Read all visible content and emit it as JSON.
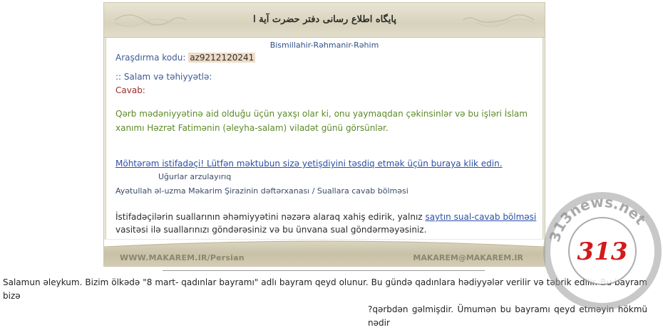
{
  "header": {
    "calligraphy_text": "پایگاه اطلاع رسانی دفتر حضرت آیة الله العظمی مکارم شیرازی"
  },
  "content": {
    "bismillah": "Bismillahir-Rəhmanir-Rəhim",
    "tracking_label": "Araşdırma kodu:",
    "tracking_code": "az9212120241",
    "greeting": ":: Salam və təhiyyətlə:",
    "answer_label": "Cavab:",
    "answer_text": "Qərb mədəniyyətinə aid olduğu üçün yaxşı olar ki, onu yaymaqdan çəkinsinlər və bu işləri İslam xanımı Həzrət Fatimənin (əleyha-salam) viladət günü görsünlər.",
    "confirm_link": "Möhtərəm istifadəçi! Lütfən məktubun sizə yetişdiyini təsdiq etmək üçün buraya klik edin.",
    "wishes": "Uğurlar arzulayırıq",
    "department": "Ayətullah əl-uzma Məkarim Şirazinin dəftərxanası / Suallara cavab bölməsi",
    "notice_pre": "İstifadəçilərin suallarının əhəmiyyətini nəzərə alaraq xahiş edirik, yalnız",
    "notice_link": "saytın sual-cavab bölməsi",
    "notice_post": "vasitəsi ilə suallarınızı göndərəsiniz və bu ünvana sual göndərməyəsiniz."
  },
  "footer": {
    "site_url": "WWW.MAKAREM.IR/Persian",
    "email": "MAKAREM@MAKAREM.IR"
  },
  "question": {
    "line1": "Salamun əleykum. Bizim ölkədə \"8 mart- qadınlar bayramı\" adlı bayram qeyd olunur. Bu gündə qadınlara hədiyyələr verilir və təbrik edilir. Bu bayram bizə",
    "line2": "?qərbdən gəlmişdir. Ümumən bu bayramı qeyd etməyin hökmü nədir"
  },
  "watermark": {
    "ring_text": "313news.net",
    "center_number": "313"
  },
  "colors": {
    "link": "#2b4fa6",
    "answer": "#5b8a28",
    "cavab_label": "#9b2a2a",
    "tracking_highlight": "#efdcc6",
    "watermark_number": "#d11b1b"
  }
}
